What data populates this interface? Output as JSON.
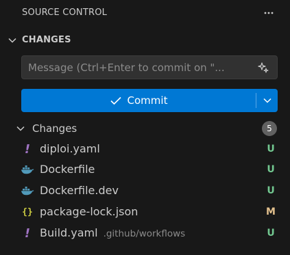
{
  "header": {
    "title": "SOURCE CONTROL",
    "more_icon": "ellipsis-icon"
  },
  "section": {
    "title": "CHANGES",
    "expanded": true
  },
  "message": {
    "placeholder": "Message (Ctrl+Enter to commit on \"...",
    "value": "",
    "action_icon": "sparkle-icon"
  },
  "commit": {
    "label": "Commit",
    "icon": "check-icon",
    "dropdown_icon": "chevron-down-icon",
    "color": "#0078d4"
  },
  "changes_group": {
    "label": "Changes",
    "count": "5"
  },
  "files": [
    {
      "name": "diploi.yaml",
      "path": "",
      "status": "U",
      "icon": "yaml-icon"
    },
    {
      "name": "Dockerfile",
      "path": "",
      "status": "U",
      "icon": "docker-icon"
    },
    {
      "name": "Dockerfile.dev",
      "path": "",
      "status": "U",
      "icon": "docker-icon"
    },
    {
      "name": "package-lock.json",
      "path": "",
      "status": "M",
      "icon": "json-icon"
    },
    {
      "name": "Build.yaml",
      "path": ".github/workflows",
      "status": "U",
      "icon": "yaml-icon"
    }
  ],
  "colors": {
    "untracked": "#73c991",
    "modified": "#e2c08d",
    "yaml": "#a074c4",
    "docker": "#519aba",
    "json": "#cbcb41"
  }
}
